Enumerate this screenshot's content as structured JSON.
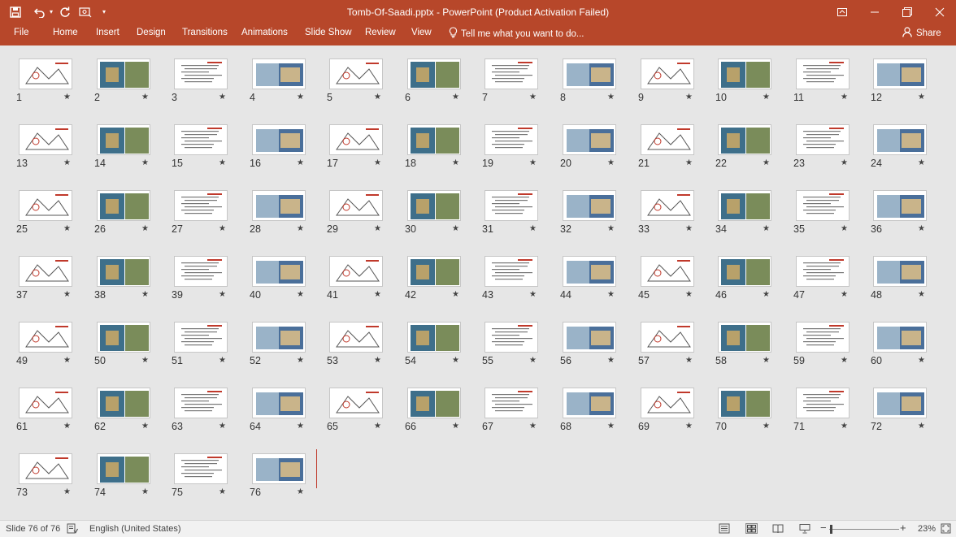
{
  "window": {
    "title": "Tomb-Of-Saadi.pptx - PowerPoint (Product Activation Failed)",
    "qa_icons": [
      "save-icon",
      "undo-icon",
      "undo-dropdown-icon",
      "redo-icon",
      "customize-icon",
      "quick-access-dropdown-icon"
    ],
    "controls": [
      "ribbon-display-icon",
      "minimize-icon",
      "restore-icon",
      "close-icon"
    ]
  },
  "ribbon": {
    "tabs": [
      "File",
      "Home",
      "Insert",
      "Design",
      "Transitions",
      "Animations",
      "Slide Show",
      "Review",
      "View"
    ],
    "tell_me": "Tell me what you want to do...",
    "share": "Share"
  },
  "colors": {
    "accent": "#b7472a",
    "workspace": "#e6e6e6",
    "insertion_marker": "#c0392b"
  },
  "slides": [
    {
      "n": "1",
      "star": "★"
    },
    {
      "n": "2",
      "star": "★"
    },
    {
      "n": "3",
      "star": "★"
    },
    {
      "n": "4",
      "star": "★"
    },
    {
      "n": "5",
      "star": "★"
    },
    {
      "n": "6",
      "star": "★"
    },
    {
      "n": "7",
      "star": "★"
    },
    {
      "n": "8",
      "star": "★"
    },
    {
      "n": "9",
      "star": "★"
    },
    {
      "n": "10",
      "star": "★"
    },
    {
      "n": "11",
      "star": "★"
    },
    {
      "n": "12",
      "star": "★"
    },
    {
      "n": "13",
      "star": "★"
    },
    {
      "n": "14",
      "star": "★"
    },
    {
      "n": "15",
      "star": "★"
    },
    {
      "n": "16",
      "star": "★"
    },
    {
      "n": "17",
      "star": "★"
    },
    {
      "n": "18",
      "star": "★"
    },
    {
      "n": "19",
      "star": "★"
    },
    {
      "n": "20",
      "star": "★"
    },
    {
      "n": "21",
      "star": "★"
    },
    {
      "n": "22",
      "star": "★"
    },
    {
      "n": "23",
      "star": "★"
    },
    {
      "n": "24",
      "star": "★"
    },
    {
      "n": "25",
      "star": "★"
    },
    {
      "n": "26",
      "star": "★"
    },
    {
      "n": "27",
      "star": "★"
    },
    {
      "n": "28",
      "star": "★"
    },
    {
      "n": "29",
      "star": "★"
    },
    {
      "n": "30",
      "star": "★"
    },
    {
      "n": "31",
      "star": "★"
    },
    {
      "n": "32",
      "star": "★"
    },
    {
      "n": "33",
      "star": "★"
    },
    {
      "n": "34",
      "star": "★"
    },
    {
      "n": "35",
      "star": "★"
    },
    {
      "n": "36",
      "star": "★"
    },
    {
      "n": "37",
      "star": "★"
    },
    {
      "n": "38",
      "star": "★"
    },
    {
      "n": "39",
      "star": "★"
    },
    {
      "n": "40",
      "star": "★"
    },
    {
      "n": "41",
      "star": "★"
    },
    {
      "n": "42",
      "star": "★"
    },
    {
      "n": "43",
      "star": "★"
    },
    {
      "n": "44",
      "star": "★"
    },
    {
      "n": "45",
      "star": "★"
    },
    {
      "n": "46",
      "star": "★"
    },
    {
      "n": "47",
      "star": "★"
    },
    {
      "n": "48",
      "star": "★"
    },
    {
      "n": "49",
      "star": "★"
    },
    {
      "n": "50",
      "star": "★"
    },
    {
      "n": "51",
      "star": "★"
    },
    {
      "n": "52",
      "star": "★"
    },
    {
      "n": "53",
      "star": "★"
    },
    {
      "n": "54",
      "star": "★"
    },
    {
      "n": "55",
      "star": "★"
    },
    {
      "n": "56",
      "star": "★"
    },
    {
      "n": "57",
      "star": "★"
    },
    {
      "n": "58",
      "star": "★"
    },
    {
      "n": "59",
      "star": "★"
    },
    {
      "n": "60",
      "star": "★"
    },
    {
      "n": "61",
      "star": "★"
    },
    {
      "n": "62",
      "star": "★"
    },
    {
      "n": "63",
      "star": "★"
    },
    {
      "n": "64",
      "star": "★"
    },
    {
      "n": "65",
      "star": "★"
    },
    {
      "n": "66",
      "star": "★"
    },
    {
      "n": "67",
      "star": "★"
    },
    {
      "n": "68",
      "star": "★"
    },
    {
      "n": "69",
      "star": "★"
    },
    {
      "n": "70",
      "star": "★"
    },
    {
      "n": "71",
      "star": "★"
    },
    {
      "n": "72",
      "star": "★"
    },
    {
      "n": "73",
      "star": "★"
    },
    {
      "n": "74",
      "star": "★"
    },
    {
      "n": "75",
      "star": "★"
    },
    {
      "n": "76",
      "star": "★"
    }
  ],
  "status": {
    "slide_count": "Slide 76 of 76",
    "language": "English (United States)",
    "zoom": "23%",
    "zoom_out": "−",
    "zoom_in": "+"
  }
}
